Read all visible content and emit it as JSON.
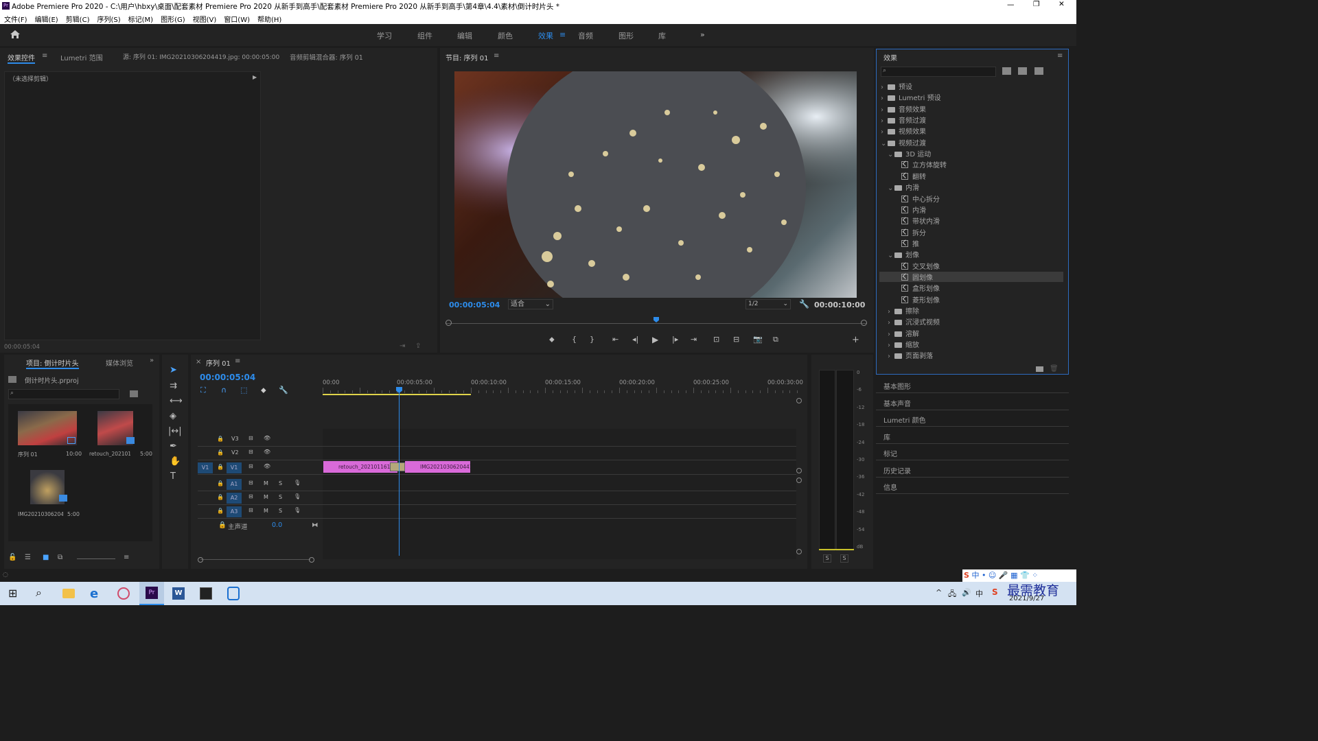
{
  "app": {
    "title": "Adobe Premiere Pro 2020 - C:\\用户\\hbxy\\桌面\\配套素材 Premiere Pro 2020 从新手到高手\\配套素材 Premiere Pro 2020 从新手到高手\\第4章\\4.4\\素材\\倒计时片头 *"
  },
  "menu": [
    "文件(F)",
    "编辑(E)",
    "剪辑(C)",
    "序列(S)",
    "标记(M)",
    "图形(G)",
    "视图(V)",
    "窗口(W)",
    "帮助(H)"
  ],
  "workspaces": [
    "学习",
    "组件",
    "编辑",
    "颜色",
    "效果",
    "音频",
    "图形",
    "库"
  ],
  "source_panel": {
    "tabs": [
      "效果控件",
      "Lumetri 范围",
      "源: 序列 01: IMG20210306204419.jpg: 00:00:05:00",
      "音频剪辑混合器: 序列 01"
    ],
    "no_clip": "（未选择剪辑）",
    "timecode": "00:00:05:04"
  },
  "program": {
    "tab": "节目: 序列 01",
    "timecode": "00:00:05:04",
    "fit": "适合",
    "quality": "1/2",
    "duration": "00:00:10:00",
    "playhead_fraction": 0.5
  },
  "project": {
    "tabs": [
      "项目: 倒计时片头",
      "媒体浏览"
    ],
    "file": "倒计时片头.prproj",
    "items": [
      {
        "name": "序列 01",
        "dur": "10:00"
      },
      {
        "name": "retouch_2021011613...",
        "dur": "5:00"
      },
      {
        "name": "IMG20210306204...",
        "dur": "5:00"
      }
    ]
  },
  "timeline": {
    "tab": "序列 01",
    "timecode": "00:00:05:04",
    "ruler": [
      "00:00",
      "00:00:05:00",
      "00:00:10:00",
      "00:00:15:00",
      "00:00:20:00",
      "00:00:25:00",
      "00:00:30:00"
    ],
    "tracks": [
      {
        "id": "V3",
        "label": "V3"
      },
      {
        "id": "V2",
        "label": "V2"
      },
      {
        "id": "V1",
        "label": "V1"
      },
      {
        "id": "A1",
        "label": "A1"
      },
      {
        "id": "A2",
        "label": "A2"
      },
      {
        "id": "A3",
        "label": "A3"
      }
    ],
    "master": "主声道",
    "master_val": "0.0",
    "clip1": "retouch_2021011613",
    "clip2": "IMG20210306204419",
    "toggle_label": "V1",
    "m": "M",
    "s": "S"
  },
  "meter": {
    "scale": [
      "0",
      "-6",
      "-12",
      "-18",
      "-24",
      "-30",
      "-36",
      "-42",
      "-48",
      "-54",
      "dB"
    ],
    "s_labels": [
      "S",
      "S"
    ]
  },
  "effects": {
    "title": "效果",
    "tree": [
      {
        "t": "f",
        "l": "预设",
        "lv": 0
      },
      {
        "t": "f",
        "l": "Lumetri 预设",
        "lv": 0
      },
      {
        "t": "f",
        "l": "音频效果",
        "lv": 0
      },
      {
        "t": "f",
        "l": "音频过渡",
        "lv": 0
      },
      {
        "t": "f",
        "l": "视频效果",
        "lv": 0
      },
      {
        "t": "fo",
        "l": "视频过渡",
        "lv": 0
      },
      {
        "t": "fo",
        "l": "3D 运动",
        "lv": 1
      },
      {
        "t": "e",
        "l": "立方体旋转",
        "lv": 2
      },
      {
        "t": "e",
        "l": "翻转",
        "lv": 2
      },
      {
        "t": "fo",
        "l": "内滑",
        "lv": 1
      },
      {
        "t": "e",
        "l": "中心拆分",
        "lv": 2
      },
      {
        "t": "e",
        "l": "内滑",
        "lv": 2
      },
      {
        "t": "e",
        "l": "带状内滑",
        "lv": 2
      },
      {
        "t": "e",
        "l": "拆分",
        "lv": 2
      },
      {
        "t": "e",
        "l": "推",
        "lv": 2
      },
      {
        "t": "fo",
        "l": "划像",
        "lv": 1
      },
      {
        "t": "e",
        "l": "交叉划像",
        "lv": 2
      },
      {
        "t": "es",
        "l": "圆划像",
        "lv": 2
      },
      {
        "t": "e",
        "l": "盒形划像",
        "lv": 2
      },
      {
        "t": "e",
        "l": "菱形划像",
        "lv": 2
      },
      {
        "t": "f",
        "l": "擦除",
        "lv": 1
      },
      {
        "t": "f",
        "l": "沉浸式视频",
        "lv": 1
      },
      {
        "t": "f",
        "l": "溶解",
        "lv": 1
      },
      {
        "t": "f",
        "l": "缩放",
        "lv": 1
      },
      {
        "t": "f",
        "l": "页面剥落",
        "lv": 1
      }
    ]
  },
  "side_panels": [
    "基本图形",
    "基本声音",
    "Lumetri 颜色",
    "库",
    "标记",
    "历史记录",
    "信息"
  ],
  "taskbar": {
    "date": "2021/9/27",
    "brand": "最需教育",
    "ime": "中"
  }
}
